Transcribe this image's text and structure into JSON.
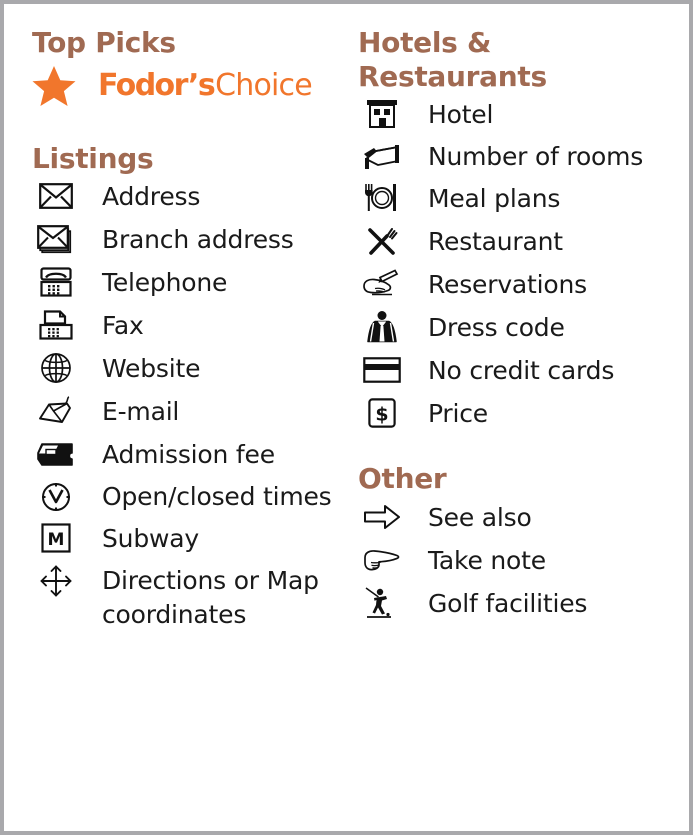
{
  "theme": {
    "heading_color": "#a06a52",
    "brand_orange": "#f1762c",
    "text_color": "#1a1a1a",
    "border_color": "#a9a9ac",
    "background": "#ffffff"
  },
  "left_column": {
    "top_picks": {
      "heading": "Top Picks",
      "brand": {
        "star_icon": "star-icon",
        "word_mark": "Fodor’s",
        "word_secondary": "Choice"
      }
    },
    "listings": {
      "heading": "Listings",
      "items": [
        {
          "icon": "envelope-icon",
          "label": "Address"
        },
        {
          "icon": "stacked-envelopes-icon",
          "label": "Branch address"
        },
        {
          "icon": "telephone-icon",
          "label": "Telephone"
        },
        {
          "icon": "fax-machine-icon",
          "label": "Fax"
        },
        {
          "icon": "globe-icon",
          "label": "Website"
        },
        {
          "icon": "computer-mouse-icon",
          "label": "E-mail"
        },
        {
          "icon": "ticket-icon",
          "label": "Admission fee"
        },
        {
          "icon": "clock-icon",
          "label": "Open/closed times"
        },
        {
          "icon": "subway-m-icon",
          "label": "Subway"
        },
        {
          "icon": "four-way-arrows-icon",
          "label": "Directions or Map coordinates"
        }
      ]
    }
  },
  "right_column": {
    "hotels_restaurants": {
      "heading": "Hotels & Restaurants",
      "items": [
        {
          "icon": "hotel-building-icon",
          "label": "Hotel"
        },
        {
          "icon": "bed-icon",
          "label": "Number of rooms"
        },
        {
          "icon": "plate-cutlery-icon",
          "label": "Meal plans"
        },
        {
          "icon": "crossed-cutlery-icon",
          "label": "Restaurant"
        },
        {
          "icon": "writing-hand-icon",
          "label": "Reservations"
        },
        {
          "icon": "jacket-person-icon",
          "label": "Dress code"
        },
        {
          "icon": "credit-card-icon",
          "label": "No credit cards"
        },
        {
          "icon": "dollar-box-icon",
          "label": "Price"
        }
      ]
    },
    "other": {
      "heading": "Other",
      "items": [
        {
          "icon": "right-arrow-icon",
          "label": "See also"
        },
        {
          "icon": "pointing-hand-icon",
          "label": "Take note"
        },
        {
          "icon": "golfer-icon",
          "label": "Golf facilities"
        }
      ]
    }
  }
}
